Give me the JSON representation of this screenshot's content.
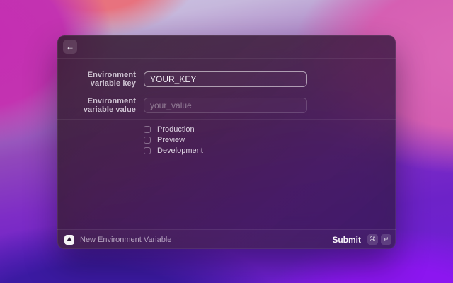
{
  "window": {
    "header": {
      "back_icon": "←"
    },
    "form": {
      "fields": [
        {
          "label": "Environment variable key",
          "value": "YOUR_KEY",
          "focused": true
        },
        {
          "label": "Environment variable value",
          "placeholder": "your_value",
          "focused": false
        }
      ],
      "environments": [
        {
          "label": "Production",
          "checked": false
        },
        {
          "label": "Preview",
          "checked": false
        },
        {
          "label": "Development",
          "checked": false
        }
      ]
    },
    "footer": {
      "title": "New Environment Variable",
      "submit_label": "Submit",
      "shortcut_keys": [
        "⌘",
        "↵"
      ]
    }
  },
  "colors": {
    "wallpaper_magenta": "#c42db2",
    "wallpaper_coral": "#e8727e",
    "wallpaper_lavender": "#ccc8e6",
    "wallpaper_pink": "#d65fb3",
    "wallpaper_violet": "#8c16f0",
    "wallpaper_deep_blue": "#3b1aa2",
    "window_tint": "#38203a",
    "focused_border": "rgba(255,255,255,0.55)"
  }
}
